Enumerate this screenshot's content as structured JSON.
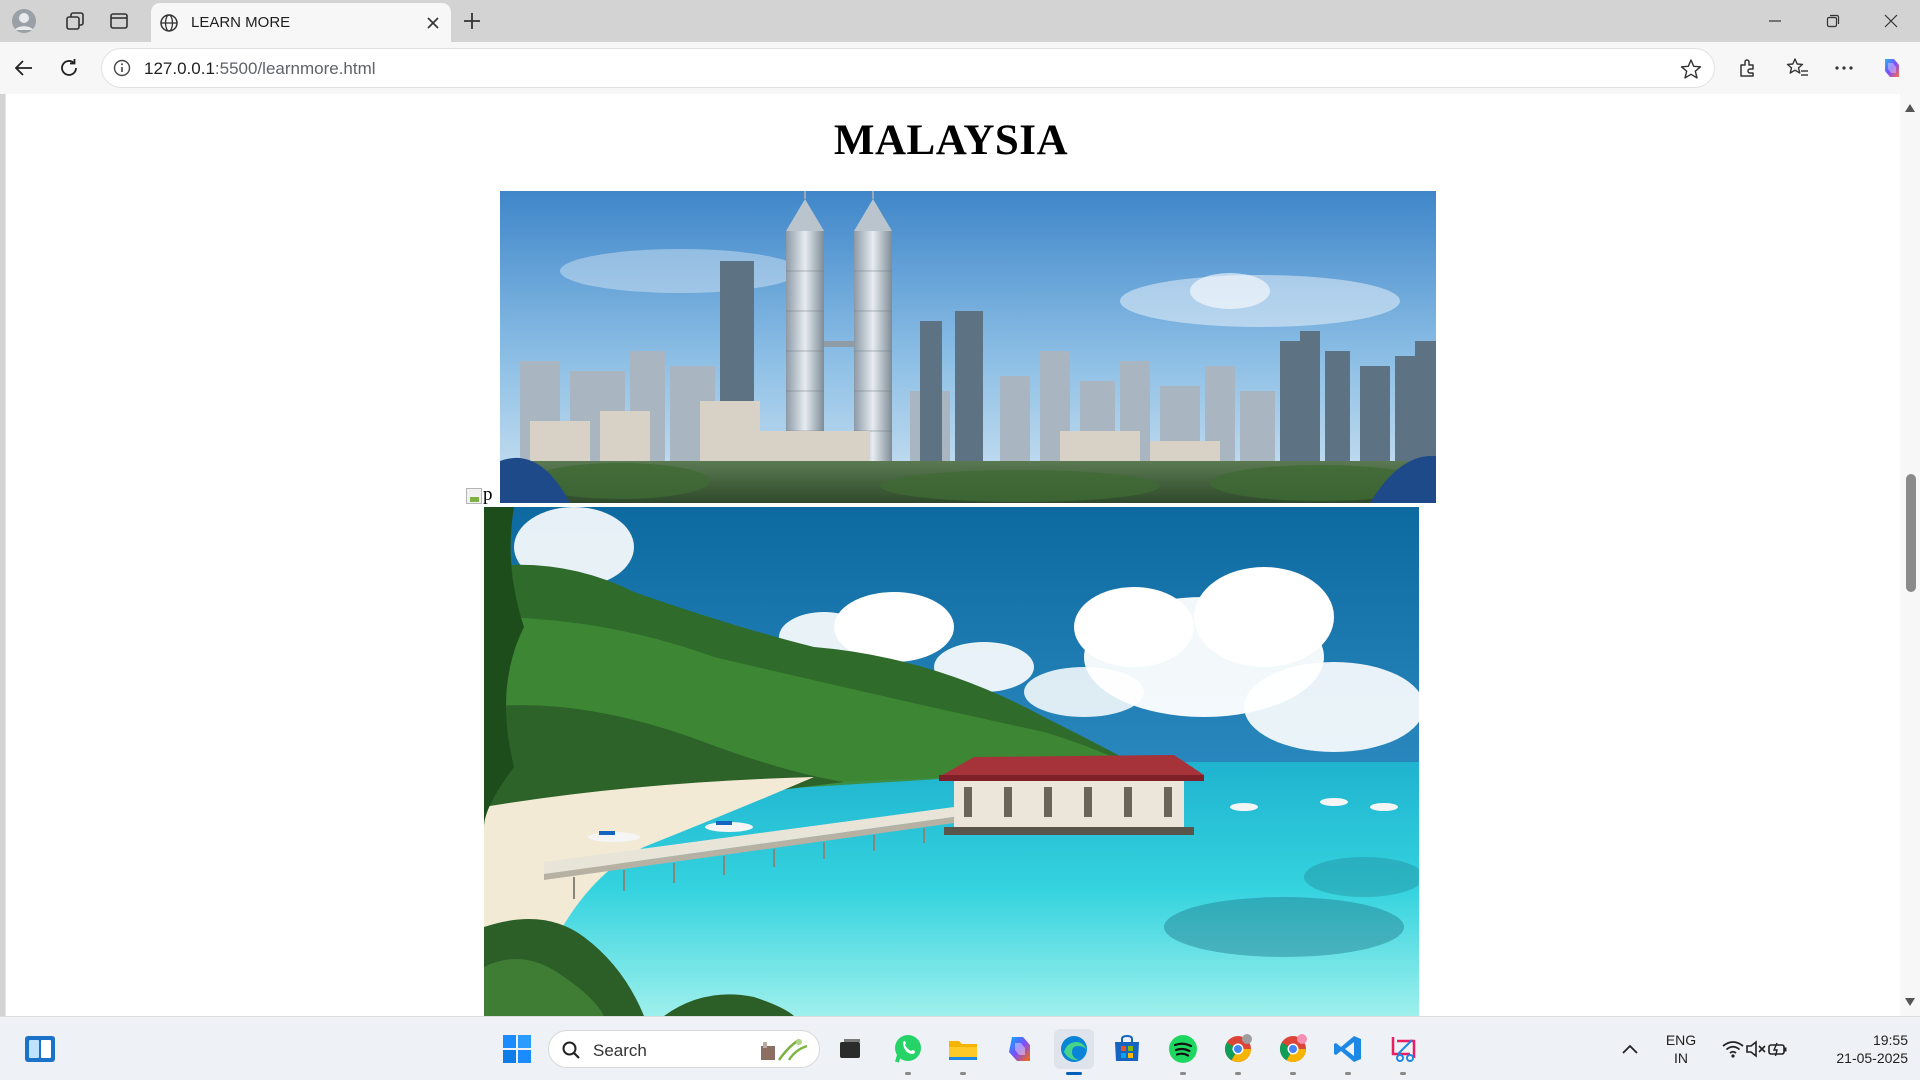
{
  "browser": {
    "tab_title": "LEARN MORE",
    "url_host": "127.0.0.1",
    "url_path": ":5500/learnmore.html"
  },
  "page": {
    "heading": "MALAYSIA",
    "broken_image_alt": "p",
    "images": [
      {
        "name": "kuala-lumpur-skyline-photo",
        "description_icon": "city-skyline"
      },
      {
        "name": "tropical-beach-pier-photo",
        "description_icon": "beach"
      }
    ]
  },
  "taskbar": {
    "search_label": "Search",
    "apps": [
      "windows-start-icon",
      "search-icon",
      "task-view-icon",
      "whatsapp-icon",
      "file-explorer-icon",
      "copilot-icon",
      "edge-icon",
      "microsoft-store-icon",
      "spotify-icon",
      "chrome-icon",
      "chrome-profile-icon",
      "vscode-icon",
      "snipping-tool-icon"
    ],
    "language_line1": "ENG",
    "language_line2": "IN",
    "time": "19:55",
    "date": "21-05-2025"
  },
  "colors": {
    "edge_blue": "#0078d4",
    "taskbar_bg": "#eef1f6",
    "titlebar_bg": "#d3d3d3"
  }
}
